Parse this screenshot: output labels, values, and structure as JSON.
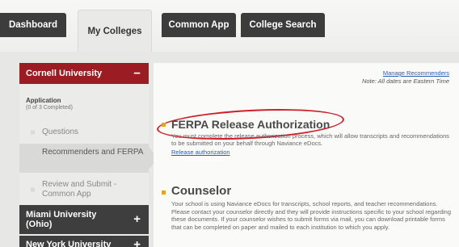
{
  "tabs": {
    "dashboard": "Dashboard",
    "my_colleges": "My Colleges",
    "common_app": "Common App",
    "college_search": "College Search"
  },
  "sidebar": {
    "colleges": [
      {
        "name": "Cornell University",
        "toggle": "−"
      },
      {
        "name": "Miami University (Ohio)",
        "toggle": "+"
      },
      {
        "name": "New York University",
        "toggle": "+"
      }
    ],
    "application": {
      "title": "Application",
      "count": "(0 of 3 Completed)",
      "steps": [
        "Questions",
        "Recommenders and FERPA",
        "Review and Submit - Common App"
      ]
    }
  },
  "main": {
    "manage_link": "Manage Recommenders",
    "note": "Note: All dates are Eastern Time",
    "ferpa": {
      "title": "FERPA Release Authorization",
      "text": "You must complete the release authorization process, which will allow transcripts and recommendations to be submitted on your behalf through Naviance eDocs.",
      "link": "Release authorization"
    },
    "counselor": {
      "title": "Counselor",
      "text": "Your school is using Naviance eDocs for transcripts, school reports, and teacher recommendations. Please contact your counselor directly and they will provide instructions specific to your school regarding these documents. If your counselor wishes to submit forms via mail, you can download printable forms that can be completed on paper and mailed to each institution to which you apply."
    }
  },
  "colors": {
    "accent_red": "#9b1c22",
    "highlight_ring": "#d01f2b",
    "bullet": "#e3a61c",
    "link": "#2a5db0"
  }
}
